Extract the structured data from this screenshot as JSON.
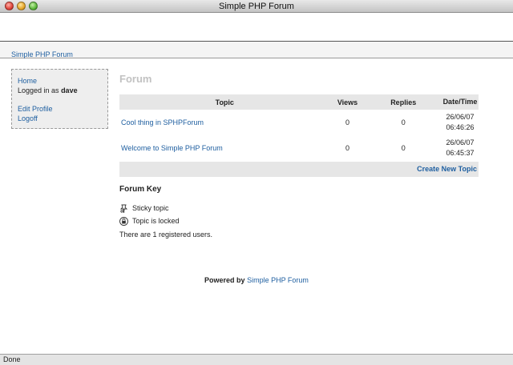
{
  "window": {
    "title": "Simple PHP Forum",
    "status": "Done"
  },
  "nav": {
    "site_link": "Simple PHP Forum"
  },
  "sidebar": {
    "home": "Home",
    "logged_in_prefix": "Logged in as",
    "username": "dave",
    "edit_profile": "Edit Profile",
    "logoff": "Logoff"
  },
  "main": {
    "title": "Forum",
    "columns": [
      "Topic",
      "Views",
      "Replies",
      "Date/Time"
    ],
    "topics": [
      {
        "title": "Cool thing in SPHPForum",
        "views": "0",
        "replies": "0",
        "date": "26/06/07",
        "time": "06:46:26"
      },
      {
        "title": "Welcome to Simple PHP Forum",
        "views": "0",
        "replies": "0",
        "date": "26/06/07",
        "time": "06:45:37"
      }
    ],
    "create_topic": "Create New Topic"
  },
  "key": {
    "heading": "Forum Key",
    "sticky_label": "Sticky topic",
    "sticky_icon": "sticky-pin-icon",
    "locked_label": "Topic is locked",
    "locked_icon": "lock-icon",
    "users_line": "There are 1 registered users."
  },
  "footer": {
    "powered_by": "Powered by",
    "link": "Simple PHP Forum"
  },
  "colors": {
    "link": "#1f5fa0",
    "table_header_bg": "#e6e6e6",
    "sidebar_bg": "#eeeeee",
    "title_gray": "#c2c2c2"
  }
}
